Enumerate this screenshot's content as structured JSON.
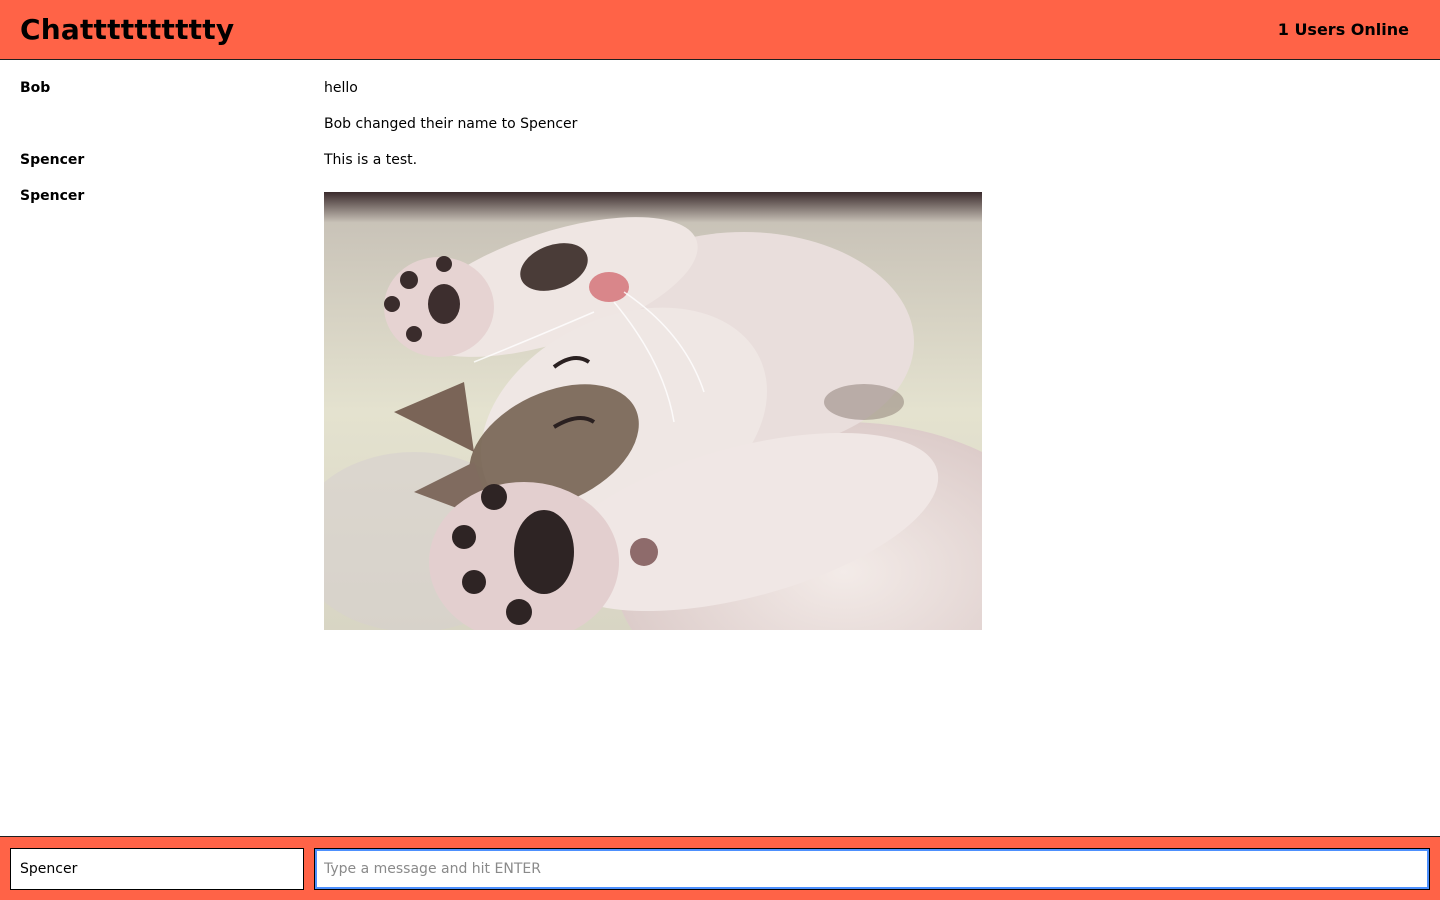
{
  "header": {
    "title": "Chatttttttttty",
    "online_status": "1 Users Online"
  },
  "messages": [
    {
      "author": "Bob",
      "text": "hello"
    },
    {
      "author": "",
      "text": "Bob changed their name to Spencer"
    },
    {
      "author": "Spencer",
      "text": "This is a test."
    },
    {
      "author": "Spencer",
      "image": "sleeping-kitten-photo"
    }
  ],
  "composer": {
    "name_value": "Spencer",
    "message_placeholder": "Type a message and hit ENTER",
    "message_value": ""
  },
  "colors": {
    "accent": "#ff6347",
    "focus_ring": "#4d90fe"
  }
}
